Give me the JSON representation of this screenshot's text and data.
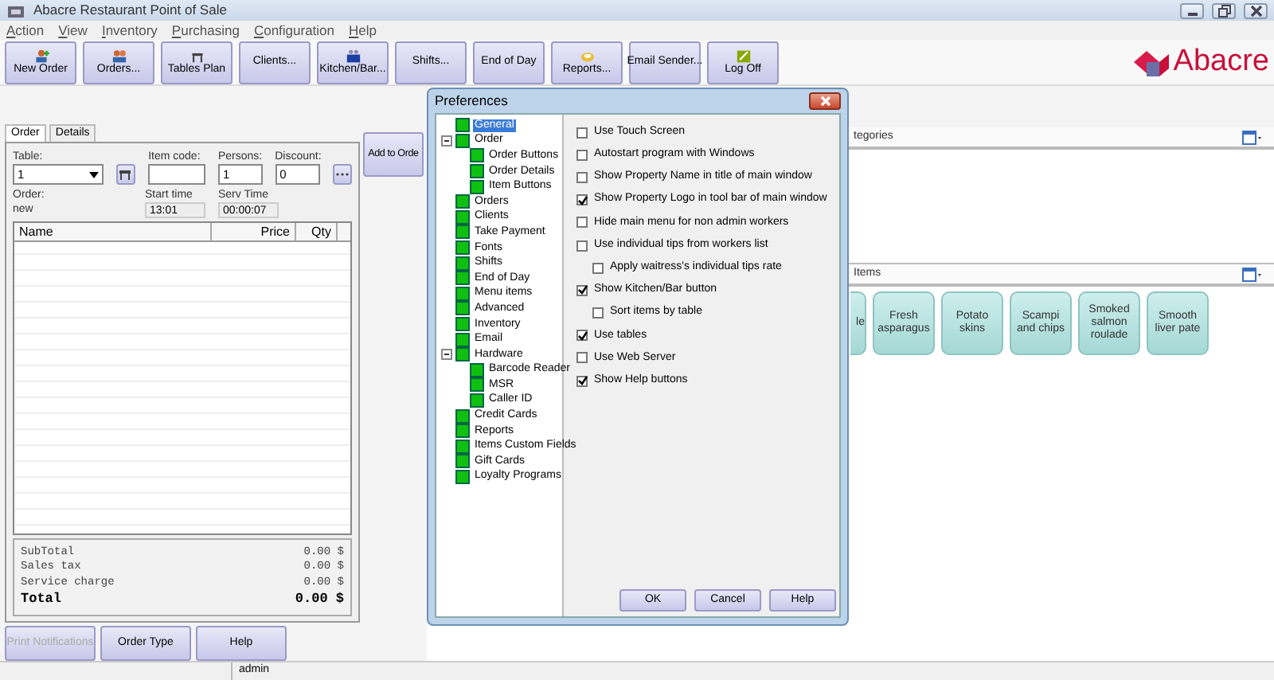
{
  "window": {
    "title": "Abacre Restaurant Point of Sale"
  },
  "menu": [
    "Action",
    "View",
    "Inventory",
    "Purchasing",
    "Configuration",
    "Help"
  ],
  "toolbar": [
    {
      "label": "New Order",
      "kind": "person-add"
    },
    {
      "label": "Orders...",
      "kind": "people"
    },
    {
      "label": "Tables Plan",
      "kind": "table"
    },
    {
      "label": "Clients..."
    },
    {
      "label": "Kitchen/Bar...",
      "kind": "kitchen"
    },
    {
      "label": "Shifts..."
    },
    {
      "label": "End of Day"
    },
    {
      "label": "Reports...",
      "kind": "report"
    },
    {
      "label": "Email Sender..."
    },
    {
      "label": "Log Off",
      "kind": "logoff"
    }
  ],
  "logo": {
    "text": "Abacre"
  },
  "order_panel": {
    "tabs": [
      {
        "label": "Order",
        "selected": true
      },
      {
        "label": "Details",
        "selected": false
      }
    ],
    "table": {
      "label": "Table:",
      "value": "1"
    },
    "item_code": {
      "label": "Item code:"
    },
    "persons": {
      "label": "Persons:",
      "value": "1"
    },
    "discount": {
      "label": "Discount:",
      "value": "0"
    },
    "order": {
      "label": "Order:",
      "value": "new"
    },
    "start_time": {
      "label": "Start time",
      "value": "13:01"
    },
    "serv_time": {
      "label": "Serv Time",
      "value": "00:00:07"
    },
    "grid": {
      "columns": [
        "Name",
        "Price",
        "Qty"
      ]
    },
    "totals": [
      {
        "label": "SubTotal",
        "value": "0.00 $",
        "kind": "line"
      },
      {
        "label": "Sales tax",
        "value": "0.00 $",
        "kind": "line"
      },
      {
        "label": "Service charge",
        "value": "0.00 $",
        "kind": "line"
      },
      {
        "label": "Total",
        "value": "0.00 $",
        "kind": "total"
      }
    ],
    "buttons": [
      {
        "label": "Print Notifications",
        "disabled": true
      },
      {
        "label": "Order Type",
        "disabled": false
      },
      {
        "label": "Help",
        "disabled": false
      }
    ]
  },
  "add_button": {
    "label": "Add to Orde"
  },
  "categories": {
    "title": "tegories"
  },
  "items": {
    "title": "Items",
    "buttons": [
      "le",
      "Fresh asparagus",
      "Potato skins",
      "Scampi and chips",
      "Smoked salmon roulade",
      "Smooth liver pate"
    ]
  },
  "dialog": {
    "title": "Preferences",
    "tree": [
      {
        "label": "General",
        "selected": true
      },
      {
        "label": "Order",
        "selected": false,
        "expanded": true,
        "children": [
          {
            "label": "Order Buttons",
            "selected": false
          },
          {
            "label": "Order Details",
            "selected": false
          },
          {
            "label": "Item Buttons",
            "selected": false
          }
        ]
      },
      {
        "label": "Orders",
        "selected": false
      },
      {
        "label": "Clients",
        "selected": false
      },
      {
        "label": "Take Payment",
        "selected": false
      },
      {
        "label": "Fonts",
        "selected": false
      },
      {
        "label": "Shifts",
        "selected": false
      },
      {
        "label": "End of Day",
        "selected": false
      },
      {
        "label": "Menu items",
        "selected": false
      },
      {
        "label": "Advanced",
        "selected": false
      },
      {
        "label": "Inventory",
        "selected": false
      },
      {
        "label": "Email",
        "selected": false
      },
      {
        "label": "Hardware",
        "selected": false,
        "expanded": true,
        "children": [
          {
            "label": "Barcode Reader",
            "selected": false
          },
          {
            "label": "MSR",
            "selected": false
          },
          {
            "label": "Caller ID",
            "selected": false
          }
        ]
      },
      {
        "label": "Credit Cards",
        "selected": false
      },
      {
        "label": "Reports",
        "selected": false
      },
      {
        "label": "Items Custom Fields",
        "selected": false
      },
      {
        "label": "Gift Cards",
        "selected": false
      },
      {
        "label": "Loyalty Programs",
        "selected": false
      }
    ],
    "options": [
      {
        "label": "Use Touch Screen",
        "checked": false
      },
      {
        "label": "Autostart program with Windows",
        "checked": false
      },
      {
        "label": "Show Property Name in title of main window",
        "checked": false
      },
      {
        "label": "Show Property Logo in tool bar of main window",
        "checked": true
      },
      {
        "label": "Hide main menu for non admin workers",
        "checked": false
      },
      {
        "label": "Use individual tips from workers list",
        "checked": false,
        "children": [
          {
            "label": "Apply waitress's individual tips rate",
            "checked": false
          }
        ]
      },
      {
        "label": "Show Kitchen/Bar button",
        "checked": true,
        "children": [
          {
            "label": "Sort items by table",
            "checked": false
          }
        ]
      },
      {
        "label": "Use tables",
        "checked": true
      },
      {
        "label": "Use Web Server",
        "checked": false
      },
      {
        "label": "Show Help buttons",
        "checked": true
      }
    ],
    "buttons": [
      "OK",
      "Cancel",
      "Help"
    ]
  },
  "status_bar": {
    "user": "admin"
  }
}
